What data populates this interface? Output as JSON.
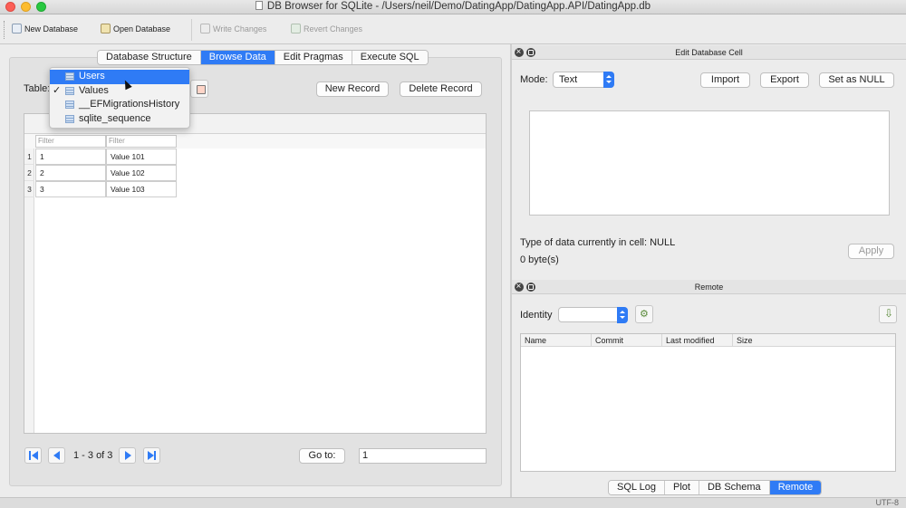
{
  "window": {
    "title": "DB Browser for SQLite - /Users/neil/Demo/DatingApp/DatingApp.API/DatingApp.db"
  },
  "toolbar": {
    "new_database": "New Database",
    "open_database": "Open Database",
    "write_changes": "Write Changes",
    "revert_changes": "Revert Changes"
  },
  "main_tabs": [
    {
      "label": "Database Structure",
      "active": false
    },
    {
      "label": "Browse Data",
      "active": true
    },
    {
      "label": "Edit Pragmas",
      "active": false
    },
    {
      "label": "Execute SQL",
      "active": false
    }
  ],
  "browse": {
    "table_label": "Table:",
    "new_record": "New Record",
    "delete_record": "Delete Record",
    "filter_placeholder": "Filter",
    "rows": [
      {
        "num": "1",
        "id": "1",
        "name": "Value 101"
      },
      {
        "num": "2",
        "id": "2",
        "name": "Value 102"
      },
      {
        "num": "3",
        "id": "3",
        "name": "Value 103"
      }
    ],
    "pager_text": "1 - 3 of 3",
    "goto_label": "Go to:",
    "goto_value": "1"
  },
  "table_dropdown": {
    "items": [
      {
        "label": "Users",
        "highlighted": true,
        "checked": false
      },
      {
        "label": "Values",
        "highlighted": false,
        "checked": true
      },
      {
        "label": "__EFMigrationsHistory",
        "highlighted": false,
        "checked": false
      },
      {
        "label": "sqlite_sequence",
        "highlighted": false,
        "checked": false
      }
    ],
    "check_mark": "✓"
  },
  "edit_cell": {
    "panel_title": "Edit Database Cell",
    "mode_label": "Mode:",
    "mode_value": "Text",
    "import": "Import",
    "export": "Export",
    "set_null": "Set as NULL",
    "type_info": "Type of data currently in cell: NULL",
    "size_info": "0 byte(s)",
    "apply": "Apply"
  },
  "remote": {
    "panel_title": "Remote",
    "identity_label": "Identity",
    "columns": [
      "Name",
      "Commit",
      "Last modified",
      "Size"
    ]
  },
  "bottom_tabs": [
    {
      "label": "SQL Log",
      "active": false
    },
    {
      "label": "Plot",
      "active": false
    },
    {
      "label": "DB Schema",
      "active": false
    },
    {
      "label": "Remote",
      "active": true
    }
  ],
  "status": {
    "encoding": "UTF-8"
  },
  "colors": {
    "accent": "#2f7bf5"
  }
}
